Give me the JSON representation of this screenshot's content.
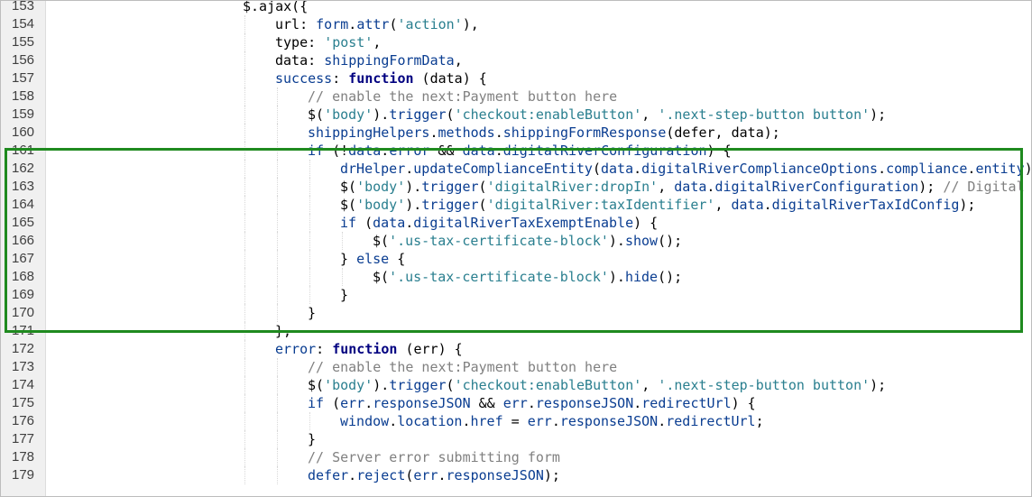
{
  "editor": {
    "lines": [
      {
        "n": "153",
        "indent": 0,
        "t": [
          [
            "o",
            "$.ajax({"
          ]
        ]
      },
      {
        "n": "154",
        "indent": 1,
        "t": [
          [
            "o",
            "url: "
          ],
          [
            "p",
            "form"
          ],
          [
            "o",
            "."
          ],
          [
            "p",
            "attr"
          ],
          [
            "o",
            "("
          ],
          [
            "s",
            "'action'"
          ],
          [
            "o",
            "),"
          ]
        ]
      },
      {
        "n": "155",
        "indent": 1,
        "t": [
          [
            "o",
            "type: "
          ],
          [
            "s",
            "'post'"
          ],
          [
            "o",
            ","
          ]
        ]
      },
      {
        "n": "156",
        "indent": 1,
        "t": [
          [
            "o",
            "data: "
          ],
          [
            "p",
            "shippingFormData"
          ],
          [
            "o",
            ","
          ]
        ]
      },
      {
        "n": "157",
        "indent": 1,
        "t": [
          [
            "p",
            "success"
          ],
          [
            "o",
            ": "
          ],
          [
            "k",
            "function"
          ],
          [
            "o",
            " (data) {"
          ]
        ]
      },
      {
        "n": "158",
        "indent": 2,
        "t": [
          [
            "c",
            "// enable the next:Payment button here"
          ]
        ]
      },
      {
        "n": "159",
        "indent": 2,
        "t": [
          [
            "o",
            "$("
          ],
          [
            "s",
            "'body'"
          ],
          [
            "o",
            ")."
          ],
          [
            "p",
            "trigger"
          ],
          [
            "o",
            "("
          ],
          [
            "s",
            "'checkout:enableButton'"
          ],
          [
            "o",
            ", "
          ],
          [
            "s",
            "'.next-step-button button'"
          ],
          [
            "o",
            ");"
          ]
        ]
      },
      {
        "n": "160",
        "indent": 2,
        "t": [
          [
            "p",
            "shippingHelpers"
          ],
          [
            "o",
            "."
          ],
          [
            "p",
            "methods"
          ],
          [
            "o",
            "."
          ],
          [
            "p",
            "shippingFormResponse"
          ],
          [
            "o",
            "(defer, data);"
          ]
        ]
      },
      {
        "n": "161",
        "indent": 2,
        "t": [
          [
            "p",
            "if"
          ],
          [
            "o",
            " (!"
          ],
          [
            "p",
            "data"
          ],
          [
            "o",
            "."
          ],
          [
            "p",
            "error"
          ],
          [
            "o",
            " && "
          ],
          [
            "p",
            "data"
          ],
          [
            "o",
            "."
          ],
          [
            "p",
            "digitalRiverConfiguration"
          ],
          [
            "o",
            ") {"
          ]
        ]
      },
      {
        "n": "162",
        "indent": 3,
        "t": [
          [
            "p",
            "drHelper"
          ],
          [
            "o",
            "."
          ],
          [
            "p",
            "updateComplianceEntity"
          ],
          [
            "o",
            "("
          ],
          [
            "p",
            "data"
          ],
          [
            "o",
            "."
          ],
          [
            "p",
            "digitalRiverComplianceOptions"
          ],
          [
            "o",
            "."
          ],
          [
            "p",
            "compliance"
          ],
          [
            "o",
            "."
          ],
          [
            "p",
            "entity"
          ],
          [
            "o",
            ");"
          ]
        ]
      },
      {
        "n": "163",
        "indent": 3,
        "t": [
          [
            "o",
            "$("
          ],
          [
            "s",
            "'body'"
          ],
          [
            "o",
            ")."
          ],
          [
            "p",
            "trigger"
          ],
          [
            "o",
            "("
          ],
          [
            "s",
            "'digitalRiver:dropIn'"
          ],
          [
            "o",
            ", "
          ],
          [
            "p",
            "data"
          ],
          [
            "o",
            "."
          ],
          [
            "p",
            "digitalRiverConfiguration"
          ],
          [
            "o",
            "); "
          ],
          [
            "c",
            "// Digital"
          ]
        ]
      },
      {
        "n": "164",
        "indent": 3,
        "t": [
          [
            "o",
            "$("
          ],
          [
            "s",
            "'body'"
          ],
          [
            "o",
            ")."
          ],
          [
            "p",
            "trigger"
          ],
          [
            "o",
            "("
          ],
          [
            "s",
            "'digitalRiver:taxIdentifier'"
          ],
          [
            "o",
            ", "
          ],
          [
            "p",
            "data"
          ],
          [
            "o",
            "."
          ],
          [
            "p",
            "digitalRiverTaxIdConfig"
          ],
          [
            "o",
            ");"
          ]
        ]
      },
      {
        "n": "165",
        "indent": 3,
        "t": [
          [
            "p",
            "if"
          ],
          [
            "o",
            " ("
          ],
          [
            "p",
            "data"
          ],
          [
            "o",
            "."
          ],
          [
            "p",
            "digitalRiverTaxExemptEnable"
          ],
          [
            "o",
            ") {"
          ]
        ]
      },
      {
        "n": "166",
        "indent": 4,
        "t": [
          [
            "o",
            "$("
          ],
          [
            "s",
            "'.us-tax-certificate-block'"
          ],
          [
            "o",
            ")."
          ],
          [
            "p",
            "show"
          ],
          [
            "o",
            "();"
          ]
        ]
      },
      {
        "n": "167",
        "indent": 3,
        "t": [
          [
            "o",
            "} "
          ],
          [
            "p",
            "else"
          ],
          [
            "o",
            " {"
          ]
        ]
      },
      {
        "n": "168",
        "indent": 4,
        "t": [
          [
            "o",
            "$("
          ],
          [
            "s",
            "'.us-tax-certificate-block'"
          ],
          [
            "o",
            ")."
          ],
          [
            "p",
            "hide"
          ],
          [
            "o",
            "();"
          ]
        ]
      },
      {
        "n": "169",
        "indent": 3,
        "t": [
          [
            "o",
            "}"
          ]
        ]
      },
      {
        "n": "170",
        "indent": 2,
        "t": [
          [
            "o",
            "}"
          ]
        ]
      },
      {
        "n": "171",
        "indent": 1,
        "t": [
          [
            "o",
            "},"
          ]
        ]
      },
      {
        "n": "172",
        "indent": 1,
        "t": [
          [
            "p",
            "error"
          ],
          [
            "o",
            ": "
          ],
          [
            "k",
            "function"
          ],
          [
            "o",
            " (err) {"
          ]
        ]
      },
      {
        "n": "173",
        "indent": 2,
        "t": [
          [
            "c",
            "// enable the next:Payment button here"
          ]
        ]
      },
      {
        "n": "174",
        "indent": 2,
        "t": [
          [
            "o",
            "$("
          ],
          [
            "s",
            "'body'"
          ],
          [
            "o",
            ")."
          ],
          [
            "p",
            "trigger"
          ],
          [
            "o",
            "("
          ],
          [
            "s",
            "'checkout:enableButton'"
          ],
          [
            "o",
            ", "
          ],
          [
            "s",
            "'.next-step-button button'"
          ],
          [
            "o",
            ");"
          ]
        ]
      },
      {
        "n": "175",
        "indent": 2,
        "t": [
          [
            "p",
            "if"
          ],
          [
            "o",
            " ("
          ],
          [
            "p",
            "err"
          ],
          [
            "o",
            "."
          ],
          [
            "p",
            "responseJSON"
          ],
          [
            "o",
            " && "
          ],
          [
            "p",
            "err"
          ],
          [
            "o",
            "."
          ],
          [
            "p",
            "responseJSON"
          ],
          [
            "o",
            "."
          ],
          [
            "p",
            "redirectUrl"
          ],
          [
            "o",
            ") {"
          ]
        ]
      },
      {
        "n": "176",
        "indent": 3,
        "t": [
          [
            "p",
            "window"
          ],
          [
            "o",
            "."
          ],
          [
            "p",
            "location"
          ],
          [
            "o",
            "."
          ],
          [
            "p",
            "href"
          ],
          [
            "o",
            " = "
          ],
          [
            "p",
            "err"
          ],
          [
            "o",
            "."
          ],
          [
            "p",
            "responseJSON"
          ],
          [
            "o",
            "."
          ],
          [
            "p",
            "redirectUrl"
          ],
          [
            "o",
            ";"
          ]
        ]
      },
      {
        "n": "177",
        "indent": 2,
        "t": [
          [
            "o",
            "}"
          ]
        ]
      },
      {
        "n": "178",
        "indent": 2,
        "t": [
          [
            "c",
            "// Server error submitting form"
          ]
        ]
      },
      {
        "n": "179",
        "indent": 2,
        "t": [
          [
            "p",
            "defer"
          ],
          [
            "o",
            "."
          ],
          [
            "p",
            "reject"
          ],
          [
            "o",
            "("
          ],
          [
            "p",
            "err"
          ],
          [
            "o",
            "."
          ],
          [
            "p",
            "responseJSON"
          ],
          [
            "o",
            ");"
          ]
        ]
      }
    ],
    "highlight": {
      "from_line": "161",
      "to_line": "170",
      "color": "#1f8a1f"
    }
  }
}
